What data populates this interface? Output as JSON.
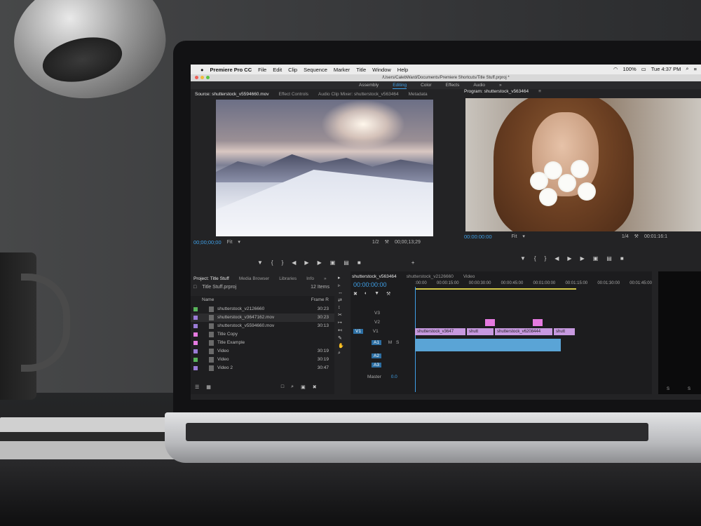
{
  "menubar": {
    "apple": "",
    "app": "Premiere Pro CC",
    "items": [
      "File",
      "Edit",
      "Clip",
      "Sequence",
      "Marker",
      "Title",
      "Window",
      "Help"
    ],
    "battery": "100%",
    "clock": "Tue 4:37 PM"
  },
  "title_path": "/Users/CalebWard/Documents/Premiere Shortcuts/Title Stuff.prproj *",
  "workspaces": [
    "Assembly",
    "Editing",
    "Color",
    "Effects",
    "Audio"
  ],
  "source_panel": {
    "tabs": [
      "Source: shutterstock_v5594660.mov",
      "Effect Controls",
      "Audio Clip Mixer: shutterstock_v563464",
      "Metadata"
    ],
    "timecode_in": "00;00;00;00",
    "fit": "Fit",
    "resolution": "1/2",
    "timecode_out": "00;00;13;29"
  },
  "program_panel": {
    "tab": "Program: shutterstock_v563464",
    "timecode": "00:00:00:00",
    "fit": "Fit",
    "resolution": "1/4",
    "timecode_out": "00:01:16:1"
  },
  "project_panel": {
    "tabs": [
      "Project: Title Stuff",
      "Media Browser",
      "Libraries",
      "Info"
    ],
    "file": "Title Stuff.prproj",
    "count": "12 Items",
    "col_name": "Name",
    "col_fr": "Frame R",
    "items": [
      {
        "name": "shutterstock_v2126660",
        "dur": "30:23",
        "color": "#58b35a"
      },
      {
        "name": "shutterstock_v3647162.mov",
        "dur": "30:23",
        "color": "#9a7bd6"
      },
      {
        "name": "shutterstock_v5594660.mov",
        "dur": "30:13",
        "color": "#9a7bd6"
      },
      {
        "name": "Title Copy",
        "dur": "",
        "color": "#e57ae0"
      },
      {
        "name": "Title Example",
        "dur": "",
        "color": "#e57ae0"
      },
      {
        "name": "Video",
        "dur": "30:19",
        "color": "#9a7bd6"
      },
      {
        "name": "Video",
        "dur": "30:19",
        "color": "#58b35a"
      },
      {
        "name": "Video 2",
        "dur": "30:47",
        "color": "#9a7bd6"
      }
    ]
  },
  "timeline": {
    "tabs": [
      "shutterstock_v563464",
      "shutterstock_v2126660",
      "Video"
    ],
    "timecode": "00:00:00:00",
    "ruler": [
      ":00:00",
      "00:00:15:00",
      "00:00:30:00",
      "00:00:45:00",
      "00:01:00:00",
      "00:01:15:00",
      "00:01:30:00",
      "00:01:45:00"
    ],
    "tracks": [
      "V3",
      "V2",
      "V1",
      "A1",
      "A2",
      "A3"
    ],
    "master": "Master",
    "master_val": "0.0",
    "v1_clips": [
      "shutterstock_v3647",
      "shutt",
      "shutterstock_v6208444",
      "shutt"
    ],
    "track_tags": [
      "V1",
      "A1"
    ],
    "mute": "M",
    "solo": "S"
  },
  "colors": {
    "accent": "#3fa0e8",
    "video_clip": "#c799e0",
    "audio_clip": "#5aa4d6",
    "title_clip": "#e57ae0"
  }
}
